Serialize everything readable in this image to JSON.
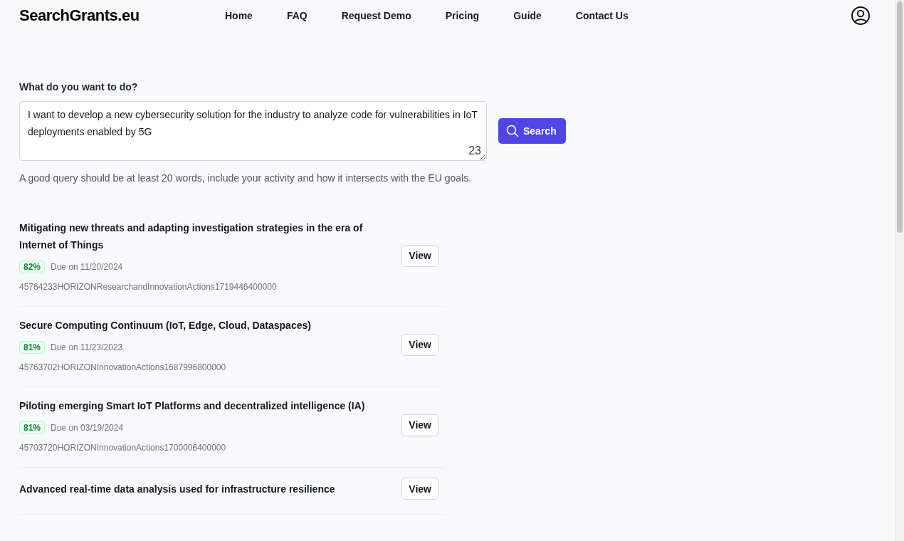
{
  "header": {
    "logo": "SearchGrants.eu",
    "nav": [
      "Home",
      "FAQ",
      "Request Demo",
      "Pricing",
      "Guide",
      "Contact Us"
    ]
  },
  "query": {
    "label": "What do you want to do?",
    "value": "I want to develop a new cybersecurity solution for the industry to analyze code for vulnerabilities in IoT deployments enabled by 5G",
    "word_count": "23",
    "button": "Search",
    "hint": "A good query should be at least 20 words, include your activity and how it intersects with the EU goals."
  },
  "results": [
    {
      "title": "Mitigating new threats and adapting investigation strategies in the era of Internet of Things",
      "score": "82%",
      "due": "Due on 11/20/2024",
      "id": "45764233HORIZONResearchandInnovationActions1719446400000",
      "button": "View"
    },
    {
      "title": "Secure Computing Continuum (IoT, Edge, Cloud, Dataspaces)",
      "score": "81%",
      "due": "Due on 11/23/2023",
      "id": "45763702HORIZONInnovationActions1687996800000",
      "button": "View"
    },
    {
      "title": "Piloting emerging Smart IoT Platforms and decentralized intelligence (IA)",
      "score": "81%",
      "due": "Due on 03/19/2024",
      "id": "45703720HORIZONInnovationActions1700006400000",
      "button": "View"
    },
    {
      "title": "Advanced real-time data analysis used for infrastructure resilience",
      "button": "View"
    }
  ]
}
